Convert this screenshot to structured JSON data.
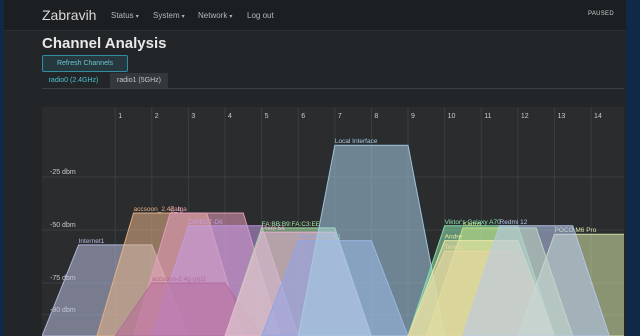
{
  "app": {
    "brand": "Zabravih",
    "nav": [
      {
        "label": "Status",
        "dropdown": true
      },
      {
        "label": "System",
        "dropdown": true
      },
      {
        "label": "Network",
        "dropdown": true
      },
      {
        "label": "Log out",
        "dropdown": false
      }
    ],
    "status_indicator": "PAUSED"
  },
  "page": {
    "title": "Channel Analysis",
    "refresh_label": "Refresh Channels",
    "tabs": [
      {
        "label": "radio0 (2.4GHz)",
        "active": true
      },
      {
        "label": "radio1 (5GHz)",
        "active": false
      }
    ]
  },
  "colors": {
    "accent": "#4cc0d3",
    "page_background": "#232628",
    "chart_background": "#2a2c2e"
  },
  "chart_data": {
    "type": "area",
    "xlabel": "",
    "ylabel": "",
    "x_ticks": [
      1,
      2,
      3,
      4,
      5,
      6,
      7,
      8,
      9,
      10,
      11,
      12,
      13,
      14
    ],
    "y_ticks": [
      {
        "value": -25,
        "label": "-25 dbm"
      },
      {
        "value": -50,
        "label": "-50 dbm"
      },
      {
        "value": -75,
        "label": "-75 dbm"
      },
      {
        "value": -90,
        "label": "-90 dbm"
      }
    ],
    "xlim": [
      -1,
      14.9
    ],
    "ylim": [
      -100,
      0
    ],
    "series": [
      {
        "name": "Internet1",
        "channel": 1,
        "signal": -57,
        "color": "#b9bfe0"
      },
      {
        "name": "accsoon_2.4g_b",
        "channel": 2.5,
        "signal": -42,
        "color": "#e8b48a"
      },
      {
        "name": "Zatga",
        "channel": 3.5,
        "signal": -42,
        "color": "#e79fbe"
      },
      {
        "name": "DIRECT-D8",
        "channel": 4,
        "signal": -48,
        "color": "#c49be6"
      },
      {
        "name": "accsoon-2.4g-grp1",
        "channel": 3,
        "signal": -75,
        "color": "#b56a9a"
      },
      {
        "name": "FA:BB:B9:FA:C3:EE",
        "channel": 6,
        "signal": -49,
        "color": "#a6e6a8"
      },
      {
        "name": "Pixel 5a",
        "channel": 6,
        "signal": -51,
        "color": "#f0b0d8"
      },
      {
        "name": "Redmi Note 11",
        "channel": 7,
        "signal": -55,
        "color": "#8fa3e8"
      },
      {
        "name": "Local Interface",
        "channel": 8,
        "signal": -10,
        "color": "#a6cde6"
      },
      {
        "name": "Viktor's Galaxy A70",
        "channel": 11,
        "signal": -48,
        "color": "#8ee6b0"
      },
      {
        "name": "Kadus",
        "channel": 11.5,
        "signal": -49,
        "color": "#c8e88a"
      },
      {
        "name": "Andre",
        "channel": 11,
        "signal": -55,
        "color": "#f0e9a8"
      },
      {
        "name": "Tenda",
        "channel": 11,
        "signal": -60,
        "color": "#e8d6a0"
      },
      {
        "name": "POCO M6 Pro",
        "channel": 14,
        "signal": -52,
        "color": "#d8ebad"
      },
      {
        "name": "Redmi 12",
        "channel": 12.5,
        "signal": -48,
        "color": "#b8c9f0"
      }
    ]
  }
}
